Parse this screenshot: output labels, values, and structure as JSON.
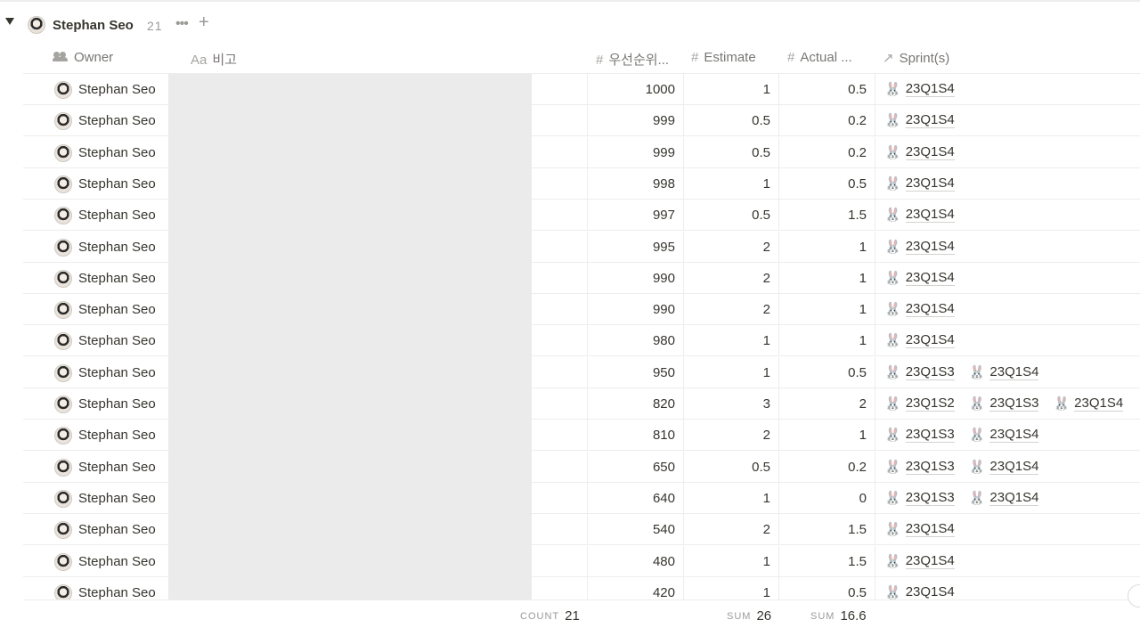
{
  "group": {
    "name": "Stephan Seo",
    "count": "21"
  },
  "columns": {
    "owner": "Owner",
    "note_prefix": "Aa",
    "note": "비고",
    "priority": "우선순위...",
    "estimate": "Estimate",
    "actual": "Actual ...",
    "sprints": "Sprint(s)"
  },
  "icons": {
    "toggle": "triangle-down-icon",
    "more": "ellipsis-icon",
    "add": "plus-icon",
    "number": "hash-icon",
    "relation": "arrow-up-right-icon",
    "people": "people-icon",
    "sprint": "rabbit-icon"
  },
  "rows": [
    {
      "owner": "Stephan Seo",
      "priority": "1000",
      "estimate": "1",
      "actual": "0.5",
      "sprints": [
        "23Q1S4"
      ]
    },
    {
      "owner": "Stephan Seo",
      "priority": "999",
      "estimate": "0.5",
      "actual": "0.2",
      "sprints": [
        "23Q1S4"
      ]
    },
    {
      "owner": "Stephan Seo",
      "priority": "999",
      "estimate": "0.5",
      "actual": "0.2",
      "sprints": [
        "23Q1S4"
      ]
    },
    {
      "owner": "Stephan Seo",
      "priority": "998",
      "estimate": "1",
      "actual": "0.5",
      "sprints": [
        "23Q1S4"
      ]
    },
    {
      "owner": "Stephan Seo",
      "priority": "997",
      "estimate": "0.5",
      "actual": "1.5",
      "sprints": [
        "23Q1S4"
      ]
    },
    {
      "owner": "Stephan Seo",
      "priority": "995",
      "estimate": "2",
      "actual": "1",
      "sprints": [
        "23Q1S4"
      ]
    },
    {
      "owner": "Stephan Seo",
      "priority": "990",
      "estimate": "2",
      "actual": "1",
      "sprints": [
        "23Q1S4"
      ]
    },
    {
      "owner": "Stephan Seo",
      "priority": "990",
      "estimate": "2",
      "actual": "1",
      "sprints": [
        "23Q1S4"
      ]
    },
    {
      "owner": "Stephan Seo",
      "priority": "980",
      "estimate": "1",
      "actual": "1",
      "sprints": [
        "23Q1S4"
      ]
    },
    {
      "owner": "Stephan Seo",
      "priority": "950",
      "estimate": "1",
      "actual": "0.5",
      "sprints": [
        "23Q1S3",
        "23Q1S4"
      ]
    },
    {
      "owner": "Stephan Seo",
      "priority": "820",
      "estimate": "3",
      "actual": "2",
      "sprints": [
        "23Q1S2",
        "23Q1S3",
        "23Q1S4"
      ]
    },
    {
      "owner": "Stephan Seo",
      "priority": "810",
      "estimate": "2",
      "actual": "1",
      "sprints": [
        "23Q1S3",
        "23Q1S4"
      ]
    },
    {
      "owner": "Stephan Seo",
      "priority": "650",
      "estimate": "0.5",
      "actual": "0.2",
      "sprints": [
        "23Q1S3",
        "23Q1S4"
      ]
    },
    {
      "owner": "Stephan Seo",
      "priority": "640",
      "estimate": "1",
      "actual": "0",
      "sprints": [
        "23Q1S3",
        "23Q1S4"
      ]
    },
    {
      "owner": "Stephan Seo",
      "priority": "540",
      "estimate": "2",
      "actual": "1.5",
      "sprints": [
        "23Q1S4"
      ]
    },
    {
      "owner": "Stephan Seo",
      "priority": "480",
      "estimate": "1",
      "actual": "1.5",
      "sprints": [
        "23Q1S4"
      ]
    },
    {
      "owner": "Stephan Seo",
      "priority": "420",
      "estimate": "1",
      "actual": "0.5",
      "sprints": [
        "23Q1S4"
      ]
    }
  ],
  "footer": {
    "count_label": "COUNT",
    "count_value": "21",
    "estimate_label": "SUM",
    "estimate_value": "26",
    "actual_label": "SUM",
    "actual_value": "16.6"
  }
}
